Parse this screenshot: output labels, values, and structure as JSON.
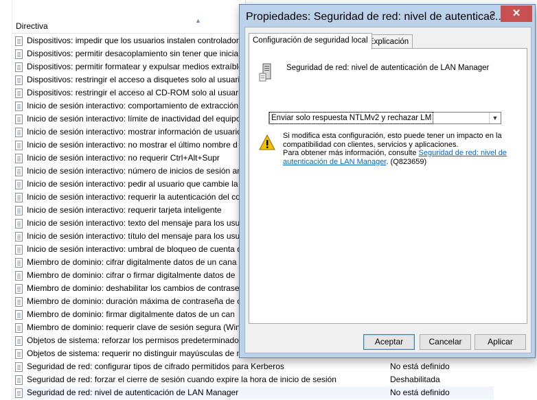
{
  "list": {
    "column_header": "Directiva",
    "rows": [
      {
        "text": "Dispositivos: impedir que los usuarios instalen controladores",
        "value": ""
      },
      {
        "text": "Dispositivos: permitir desacoplamiento sin tener que iniciar",
        "value": ""
      },
      {
        "text": "Dispositivos: permitir formatear y expulsar medios extraíble",
        "value": ""
      },
      {
        "text": "Dispositivos: restringir el acceso a disquetes solo al usuario",
        "value": ""
      },
      {
        "text": "Dispositivos: restringir el acceso al CD-ROM solo al usuario",
        "value": ""
      },
      {
        "text": "Inicio de sesión interactivo: comportamiento de extracción",
        "value": ""
      },
      {
        "text": "Inicio de sesión interactivo: límite de inactividad del equipo",
        "value": ""
      },
      {
        "text": "Inicio de sesión interactivo: mostrar información de usuario",
        "value": ""
      },
      {
        "text": "Inicio de sesión interactivo: no mostrar el último nombre d",
        "value": ""
      },
      {
        "text": "Inicio de sesión interactivo: no requerir Ctrl+Alt+Supr",
        "value": ""
      },
      {
        "text": "Inicio de sesión interactivo: número de inicios de sesión an",
        "value": ""
      },
      {
        "text": "Inicio de sesión interactivo: pedir al usuario que cambie la c",
        "value": ""
      },
      {
        "text": "Inicio de sesión interactivo: requerir la autenticación del co",
        "value": ""
      },
      {
        "text": "Inicio de sesión interactivo: requerir tarjeta inteligente",
        "value": ""
      },
      {
        "text": "Inicio de sesión interactivo: texto del mensaje para los usua",
        "value": ""
      },
      {
        "text": "Inicio de sesión interactivo: título del mensaje para los usu",
        "value": ""
      },
      {
        "text": "Inicio de sesión interactivo: umbral de bloqueo de cuenta d",
        "value": ""
      },
      {
        "text": "Miembro de dominio: cifrar digitalmente datos de un cana",
        "value": ""
      },
      {
        "text": "Miembro de dominio: cifrar o firmar digitalmente datos de",
        "value": ""
      },
      {
        "text": "Miembro de dominio: deshabilitar los cambios de contrase",
        "value": ""
      },
      {
        "text": "Miembro de dominio: duración máxima de contraseña de c",
        "value": ""
      },
      {
        "text": "Miembro de dominio: firmar digitalmente datos de un can",
        "value": ""
      },
      {
        "text": "Miembro de dominio: requerir clave de sesión segura (Win",
        "value": ""
      },
      {
        "text": "Objetos de sistema: reforzar los permisos predeterminados",
        "value": ""
      },
      {
        "text": "Objetos de sistema: requerir no distinguir mayúsculas de m",
        "value": ""
      },
      {
        "text": "Seguridad de red: configurar tipos de cifrado permitidos para Kerberos",
        "value": "No está definido"
      },
      {
        "text": "Seguridad de red: forzar el cierre de sesión cuando expire la hora de inicio de sesión",
        "value": "Deshabilitada"
      },
      {
        "text": "Seguridad de red: nivel de autenticación de LAN Manager",
        "value": "No está definido"
      }
    ]
  },
  "dialog": {
    "title": "Propiedades: Seguridad de red: nivel de autenticac...",
    "help_glyph": "?",
    "close_glyph": "✕",
    "tabs": [
      "Configuración de seguridad local",
      "Explicación"
    ],
    "policy_name": "Seguridad de red: nivel de autenticación de LAN Manager",
    "dropdown_value": "Enviar solo respuesta NTLMv2 y rechazar LM",
    "warning_line1": "Si modifica esta configuración, esto puede tener un impacto en la compatibilidad con clientes, servicios y aplicaciones.",
    "warning_line2_prefix": "Para obtener más información, consulte ",
    "warning_link": "Seguridad de red: nivel de autenticación de LAN Manager",
    "warning_suffix": ". (Q823659)",
    "buttons": {
      "ok": "Aceptar",
      "cancel": "Cancelar",
      "apply": "Aplicar"
    }
  },
  "colors": {
    "title_bar": "#bcd1ea",
    "close_button": "#c75050",
    "link": "#0066cc",
    "selected_row": "#f1f6fd"
  }
}
